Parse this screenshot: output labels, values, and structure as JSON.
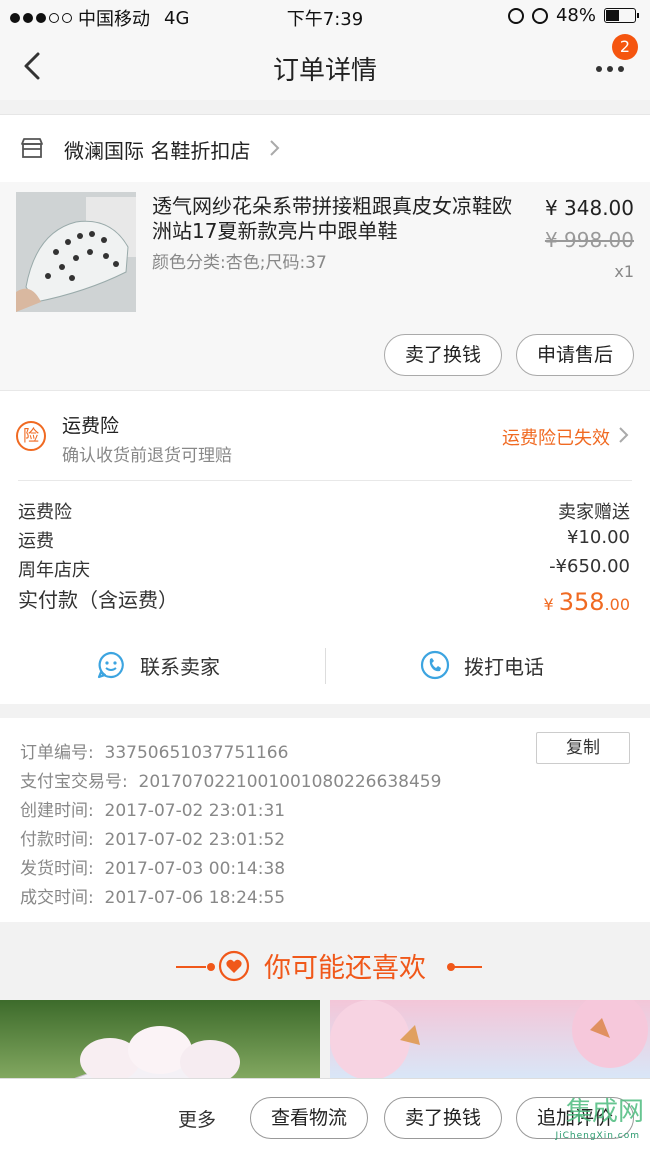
{
  "status_bar": {
    "carrier": "中国移动",
    "network": "4G",
    "time": "下午7:39",
    "battery": "48%",
    "battery_level": 0.48
  },
  "nav": {
    "title": "订单详情",
    "badge": "2"
  },
  "shop": {
    "name": "微澜国际 名鞋折扣店"
  },
  "item": {
    "title": "透气网纱花朵系带拼接粗跟真皮女凉鞋欧洲站17夏新款亮片中跟单鞋",
    "spec": "颜色分类:杏色;尺码:37",
    "price": "¥ 348.00",
    "original_price": "¥ 998.00",
    "quantity": "x1",
    "buttons": {
      "sell": "卖了换钱",
      "after_sale": "申请售后"
    }
  },
  "insurance": {
    "icon_char": "险",
    "title": "运费险",
    "subtitle": "确认收货前退货可理赔",
    "status": "运费险已失效"
  },
  "fees": {
    "rows": [
      {
        "label": "运费险",
        "value": "卖家赠送"
      },
      {
        "label": "运费",
        "value": "¥10.00"
      },
      {
        "label": "周年店庆",
        "value": "-¥650.00"
      }
    ],
    "total_label": "实付款（含运费）",
    "total_currency": "¥",
    "total_int": "358",
    "total_dec": ".00"
  },
  "contact": {
    "seller": "联系卖家",
    "call": "拨打电话"
  },
  "order_info": {
    "copy_label": "复制",
    "rows": [
      {
        "label": "订单编号:",
        "value": "33750651037751166"
      },
      {
        "label": "支付宝交易号:",
        "value": "2017070221001001080226638459"
      },
      {
        "label": "创建时间:",
        "value": "2017-07-02 23:01:31"
      },
      {
        "label": "付款时间:",
        "value": "2017-07-02 23:01:52"
      },
      {
        "label": "发货时间:",
        "value": "2017-07-03 00:14:38"
      },
      {
        "label": "成交时间:",
        "value": "2017-07-06 18:24:55"
      }
    ]
  },
  "recommend": {
    "title": "你可能还喜欢"
  },
  "bottom_bar": {
    "more": "更多",
    "logistics": "查看物流",
    "sell": "卖了换钱",
    "review": "追加评价"
  },
  "watermark": {
    "cn": "集成网",
    "url": "JiChengXin.com"
  },
  "colors": {
    "accent": "#f06a22",
    "badge": "#f5550f",
    "contact_icon": "#3ca4e0"
  }
}
